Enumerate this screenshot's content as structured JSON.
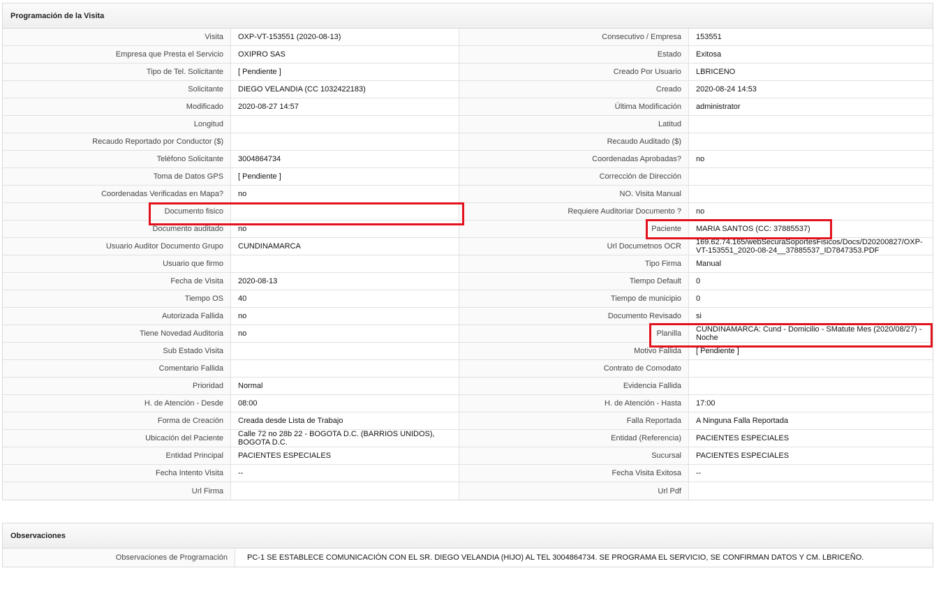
{
  "visit_panel": {
    "title": "Programación de la Visita",
    "rows": [
      [
        "Visita",
        "OXP-VT-153551 (2020-08-13)",
        "Consecutivo / Empresa",
        "153551"
      ],
      [
        "Empresa que Presta el Servicio",
        "OXIPRO SAS",
        "Estado",
        "Exitosa"
      ],
      [
        "Tipo de Tel. Solicitante",
        "[ Pendiente ]",
        "Creado Por Usuario",
        "LBRICENO"
      ],
      [
        "Solicitante",
        "DIEGO VELANDIA (CC 1032422183)",
        "Creado",
        "2020-08-24 14:53"
      ],
      [
        "Modificado",
        "2020-08-27 14:57",
        "Última Modificación",
        " administrator"
      ],
      [
        "Longitud",
        "",
        "Latitud",
        ""
      ],
      [
        "Recaudo Reportado por Conductor ($)",
        "",
        "Recaudo Auditado ($)",
        ""
      ],
      [
        "Teléfono Solicitante",
        "3004864734",
        "Coordenadas Aprobadas?",
        " no"
      ],
      [
        "Toma de Datos GPS",
        "[ Pendiente ]",
        "Corrección de Dirección",
        ""
      ],
      [
        "Coordenadas Verificadas en Mapa?",
        " no",
        "NO. Visita Manual",
        ""
      ],
      [
        "Documento fisico",
        "",
        "Requiere Auditoriar Documento ?",
        " no"
      ],
      [
        "Documento auditado",
        " no",
        "Paciente",
        "MARIA SANTOS (CC: 37885537)"
      ],
      [
        "Usuario Auditor Documento Grupo",
        "CUNDINAMARCA",
        "Url Documetnos OCR",
        " 169.62.74.165/webSecuraSoportesFisicos/Docs/D20200827/OXP-VT-153551_2020-08-24__37885537_ID7847353.PDF"
      ],
      [
        "Usuario que firmo",
        "",
        "Tipo Firma",
        "Manual"
      ],
      [
        "Fecha de Visita",
        " 2020-08-13",
        "Tiempo Default",
        "0"
      ],
      [
        "Tiempo OS",
        "40",
        "Tiempo de municipio",
        "0"
      ],
      [
        "Autorizada Fallida",
        " no",
        "Documento Revisado",
        " si"
      ],
      [
        "Tiene Novedad Auditoria",
        " no",
        "Planilla",
        "CUNDINAMARCA: Cund - Domicilio - SMatute Mes (2020/08/27) - Noche"
      ],
      [
        "Sub Estado Visita",
        "",
        "Motivo Fallida",
        "[ Pendiente ]"
      ],
      [
        "Comentario Fallida",
        "",
        "Contrato de Comodato",
        ""
      ],
      [
        "Prioridad",
        "Normal",
        "Evidencia Fallida",
        ""
      ],
      [
        "H. de Atención - Desde",
        "08:00",
        "H. de Atención - Hasta",
        "17:00"
      ],
      [
        "Forma de Creación",
        "Creada desde Lista de Trabajo",
        "Falla Reportada",
        "A Ninguna Falla Reportada"
      ],
      [
        "Ubicación del Paciente",
        "Calle 72 no 28b 22 - BOGOTA D.C. (BARRIOS UNIDOS), BOGOTA D.C.",
        "Entidad (Referencia)",
        "PACIENTES ESPECIALES"
      ],
      [
        "Entidad Principal",
        "PACIENTES ESPECIALES",
        "Sucursal",
        "PACIENTES ESPECIALES"
      ],
      [
        "Fecha Intento Visita",
        " --",
        "Fecha Visita Exitosa",
        " --"
      ],
      [
        "Url Firma",
        "",
        "Url Pdf",
        ""
      ]
    ]
  },
  "observations_panel": {
    "title": "Observaciones",
    "label": "Observaciones de Programación",
    "value": "PC-1 SE ESTABLECE COMUNICACIÓN CON EL SR. DIEGO VELANDIA (HIJO) AL TEL 3004864734. SE PROGRAMA EL SERVICIO, SE CONFIRMAN DATOS Y CM. LBRICEÑO."
  },
  "colors": {
    "highlight": "#e3111c",
    "border": "#d9d9d9"
  }
}
